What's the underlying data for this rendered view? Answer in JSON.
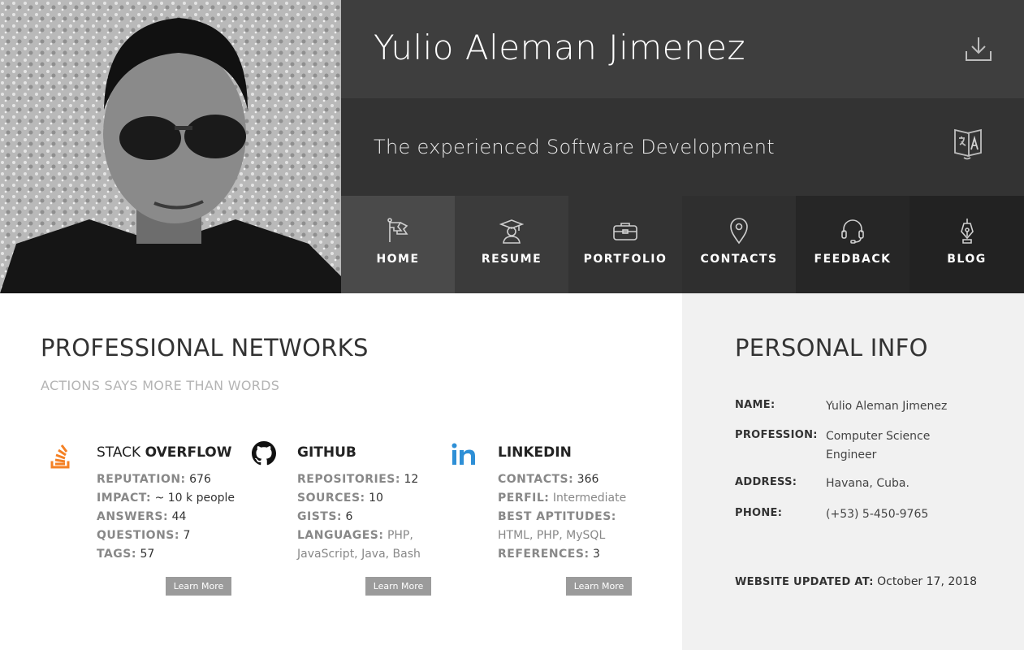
{
  "header": {
    "name": "Yulio Aleman Jimenez",
    "tagline": "The experienced Software Development",
    "download_icon": "download-icon",
    "translate_icon": "translate-icon"
  },
  "nav": [
    {
      "label": "HOME",
      "icon": "flag-icon"
    },
    {
      "label": "RESUME",
      "icon": "graduate-icon"
    },
    {
      "label": "PORTFOLIO",
      "icon": "briefcase-icon"
    },
    {
      "label": "CONTACTS",
      "icon": "map-pin-icon"
    },
    {
      "label": "FEEDBACK",
      "icon": "headset-icon"
    },
    {
      "label": "BLOG",
      "icon": "pen-icon"
    }
  ],
  "main": {
    "title": "PROFESSIONAL NETWORKS",
    "subtitle": "ACTIONS SAYS MORE THAN WORDS",
    "learn_more": "Learn More",
    "networks": [
      {
        "title_light": "STACK ",
        "title_bold": "OVERFLOW",
        "icon": "stackoverflow-icon",
        "color": "#f48024",
        "rows": [
          {
            "k": "REPUTATION:",
            "v": "676"
          },
          {
            "k": "IMPACT:",
            "v": "~ 10 k people"
          },
          {
            "k": "ANSWERS:",
            "v": "44"
          },
          {
            "k": "QUESTIONS:",
            "v": "7"
          },
          {
            "k": "TAGS:",
            "v": "57"
          }
        ]
      },
      {
        "title_light": "",
        "title_bold": "GITHUB",
        "icon": "github-icon",
        "color": "#111111",
        "rows": [
          {
            "k": "REPOSITORIES:",
            "v": "12"
          },
          {
            "k": "SOURCES:",
            "v": "10"
          },
          {
            "k": "GISTS:",
            "v": "6"
          },
          {
            "k": "LANGUAGES:",
            "v": "PHP, JavaScript, Java, Bash"
          }
        ]
      },
      {
        "title_light": "",
        "title_bold": "LINKEDIN",
        "icon": "linkedin-icon",
        "color": "#2e8fd6",
        "rows": [
          {
            "k": "CONTACTS:",
            "v": "366"
          },
          {
            "k": "PERFIL:",
            "v": "Intermediate"
          },
          {
            "k": "BEST APTITUDES:",
            "v": "HTML, PHP, MySQL"
          },
          {
            "k": "REFERENCES:",
            "v": "3"
          }
        ]
      }
    ]
  },
  "aside": {
    "title": "PERSONAL INFO",
    "rows": [
      {
        "k": "NAME:",
        "v": "Yulio Aleman Jimenez"
      },
      {
        "k": "PROFESSION:",
        "v": "Computer Science Engineer"
      },
      {
        "k": "ADDRESS:",
        "v": "Havana, Cuba."
      },
      {
        "k": "PHONE:",
        "v": "(+53) 5-450-9765"
      }
    ],
    "updated_label": "WEBSITE UPDATED AT:",
    "updated_value": "October 17, 2018"
  }
}
